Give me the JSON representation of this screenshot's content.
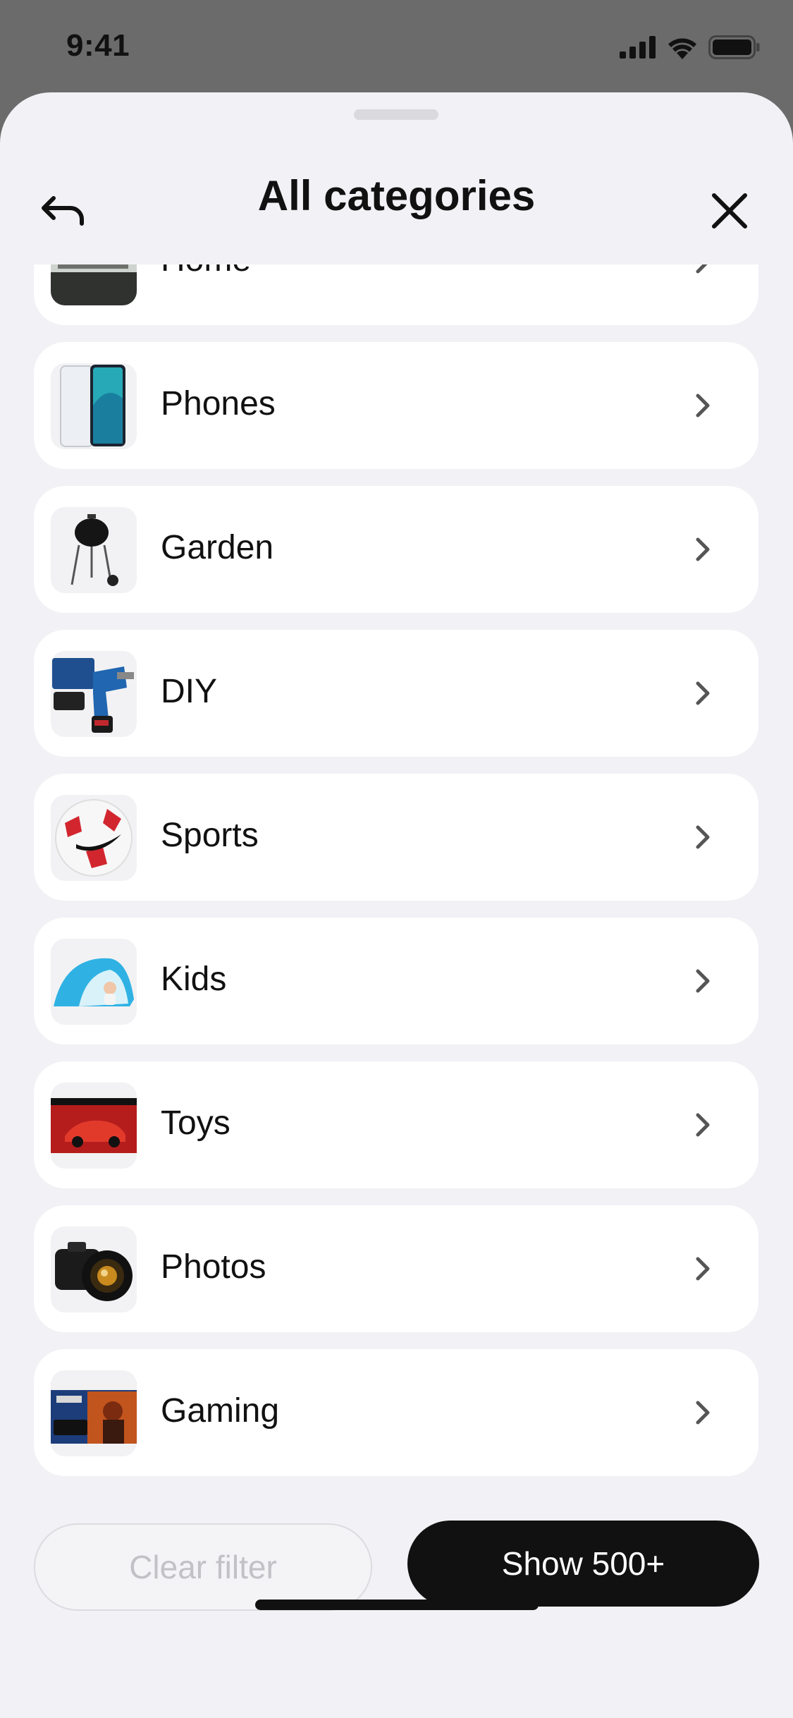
{
  "status_bar": {
    "time": "9:41",
    "icons": [
      "cellular-signal-icon",
      "wifi-icon",
      "battery-icon"
    ]
  },
  "header": {
    "title": "All categories",
    "back_icon": "back-arrow-icon",
    "close_icon": "close-icon"
  },
  "categories": [
    {
      "label": "Home",
      "thumb": "house-photo"
    },
    {
      "label": "Phones",
      "thumb": "smartphone-photo"
    },
    {
      "label": "Garden",
      "thumb": "barbecue-grill-photo"
    },
    {
      "label": "DIY",
      "thumb": "power-drill-photo"
    },
    {
      "label": "Sports",
      "thumb": "football-photo"
    },
    {
      "label": "Kids",
      "thumb": "beach-tent-photo"
    },
    {
      "label": "Toys",
      "thumb": "car-model-box-photo"
    },
    {
      "label": "Photos",
      "thumb": "camera-photo"
    },
    {
      "label": "Gaming",
      "thumb": "console-bundle-photo"
    }
  ],
  "footer": {
    "clear_label": "Clear filter",
    "show_label": "Show 500+"
  },
  "colors": {
    "sheet_background": "#f1f1f6",
    "card_background": "#ffffff",
    "primary_button": "#111111",
    "dimmed_backdrop": "#6b6b6b"
  }
}
